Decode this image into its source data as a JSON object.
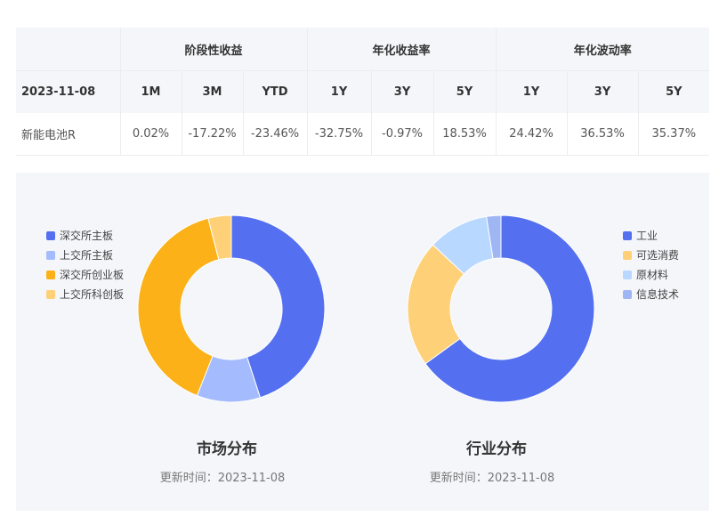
{
  "table": {
    "groups": [
      "阶段性收益",
      "年化收益率",
      "年化波动率"
    ],
    "date": "2023-11-08",
    "periods": [
      "1M",
      "3M",
      "YTD",
      "1Y",
      "3Y",
      "5Y",
      "1Y",
      "3Y",
      "5Y"
    ],
    "row": {
      "name": "新能电池R",
      "values": [
        "0.02%",
        "-17.22%",
        "-23.46%",
        "-32.75%",
        "-0.97%",
        "18.53%",
        "24.42%",
        "36.53%",
        "35.37%"
      ]
    }
  },
  "chart_data": [
    {
      "type": "pie",
      "title": "市场分布",
      "update_label": "更新时间：2023-11-08",
      "legend_position": "left",
      "categories": [
        "深交所主板",
        "上交所主板",
        "深交所创业板",
        "上交所科创板"
      ],
      "values": [
        45,
        11,
        40,
        4
      ],
      "colors": [
        "#5470f0",
        "#a4bcfd",
        "#fbb117",
        "#fed078"
      ]
    },
    {
      "type": "pie",
      "title": "行业分布",
      "update_label": "更新时间：2023-11-08",
      "legend_position": "right",
      "categories": [
        "工业",
        "可选消费",
        "原材料",
        "信息技术"
      ],
      "values": [
        65,
        22,
        10.5,
        2.5
      ],
      "colors": [
        "#5470f0",
        "#fed078",
        "#b8d8ff",
        "#9fb6f5"
      ]
    }
  ]
}
